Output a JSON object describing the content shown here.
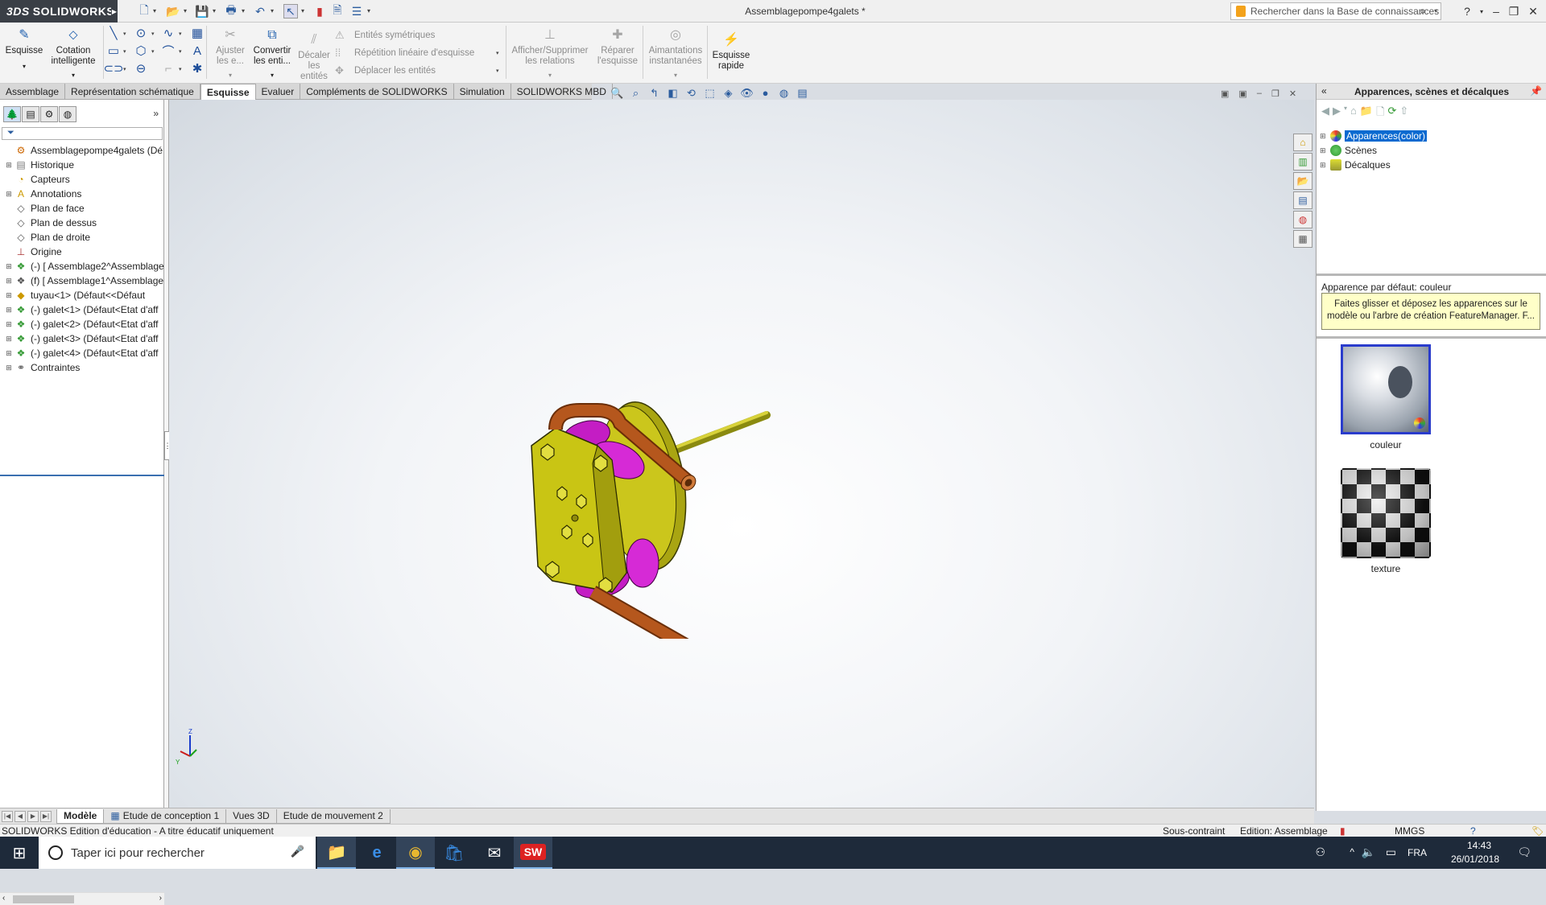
{
  "app": {
    "brand": "SOLIDWORKS",
    "document_title": "Assemblagepompe4galets *",
    "search_placeholder": "Rechercher dans la Base de connaissances"
  },
  "ribbon": {
    "sketch": "Esquisse",
    "smart_dim_1": "Cotation",
    "smart_dim_2": "intelligente",
    "trim_1": "Ajuster",
    "trim_2": "les e...",
    "convert_1": "Convertir",
    "convert_2": "les enti...",
    "offset_1": "Décaler",
    "offset_2": "les",
    "offset_3": "entités",
    "mirror": "Entités symétriques",
    "linear_pattern": "Répétition linéaire d'esquisse",
    "move": "Déplacer les entités",
    "relations_1": "Afficher/Supprimer",
    "relations_2": "les relations",
    "repair_1": "Réparer",
    "repair_2": "l'esquisse",
    "snaps_1": "Aimantations",
    "snaps_2": "instantanées",
    "rapid_1": "Esquisse",
    "rapid_2": "rapide"
  },
  "tabs": [
    "Assemblage",
    "Représentation schématique",
    "Esquisse",
    "Evaluer",
    "Compléments de SOLIDWORKS",
    "Simulation",
    "SOLIDWORKS MBD"
  ],
  "active_tab": "Esquisse",
  "tree": [
    {
      "label": "Assemblagepompe4galets  (Dé",
      "icon": "assembly-icon"
    },
    {
      "label": "Historique",
      "icon": "history-icon"
    },
    {
      "label": "Capteurs",
      "icon": "sensors-icon"
    },
    {
      "label": "Annotations",
      "icon": "annotations-icon"
    },
    {
      "label": "Plan de face",
      "icon": "plane-icon"
    },
    {
      "label": "Plan de dessus",
      "icon": "plane-icon"
    },
    {
      "label": "Plan de droite",
      "icon": "plane-icon"
    },
    {
      "label": "Origine",
      "icon": "origin-icon"
    },
    {
      "label": "(-) [ Assemblage2^Assemblage",
      "icon": "subassembly-icon"
    },
    {
      "label": "(f) [ Assemblage1^Assemblage",
      "icon": "subassembly-icon"
    },
    {
      "label": "tuyau<1> (Défaut<<Défaut",
      "icon": "part-icon"
    },
    {
      "label": "(-) galet<1> (Défaut<Etat d'aff",
      "icon": "subassembly-icon"
    },
    {
      "label": "(-) galet<2> (Défaut<Etat d'aff",
      "icon": "subassembly-icon"
    },
    {
      "label": "(-) galet<3> (Défaut<Etat d'aff",
      "icon": "subassembly-icon"
    },
    {
      "label": "(-) galet<4> (Défaut<Etat d'aff",
      "icon": "subassembly-icon"
    },
    {
      "label": "Contraintes",
      "icon": "mates-icon"
    }
  ],
  "right_pane": {
    "title": "Apparences, scènes et décalques",
    "tree": [
      "Apparences(color)",
      "Scènes",
      "Décalques"
    ],
    "default_appearance": "Apparence par défaut: couleur",
    "tip": "Faites glisser et déposez les apparences sur le modèle ou l'arbre de création FeatureManager. F...",
    "swatches": [
      "couleur",
      "texture"
    ]
  },
  "bottom_tabs": [
    "Modèle",
    "Etude de conception 1",
    "Vues 3D",
    "Etude de mouvement 2"
  ],
  "status": {
    "left": "SOLIDWORKS Edition d'éducation - A titre éducatif uniquement",
    "state": "Sous-contraint",
    "mode": "Edition: Assemblage",
    "units": "MMGS"
  },
  "taskbar": {
    "search": "Taper ici pour rechercher",
    "lang": "FRA",
    "time": "14:43",
    "date": "26/01/2018"
  },
  "colors": {
    "plate": "#c9c514",
    "tube": "#b5571d",
    "roller": "#cc22cc",
    "accent": "#0a6ad0"
  }
}
